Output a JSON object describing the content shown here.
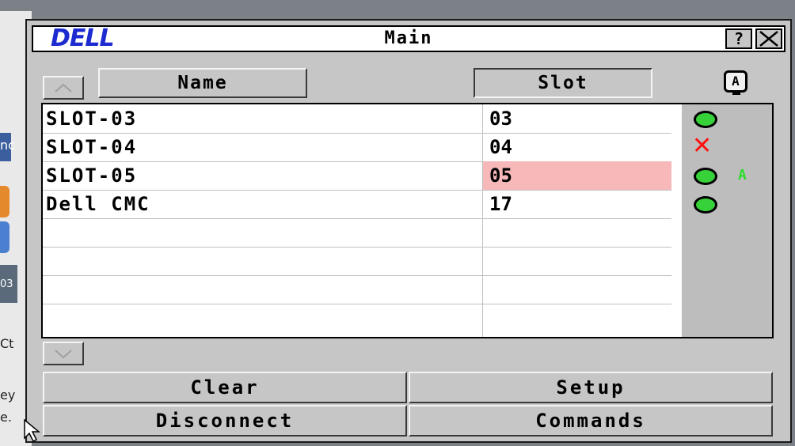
{
  "background": {
    "texts": [
      "nc",
      "Ct",
      "ey",
      "e.",
      "03"
    ]
  },
  "window": {
    "logo": "DELL",
    "title": "Main",
    "help_label": "?",
    "close_label": "X"
  },
  "header": {
    "name_label": "Name",
    "slot_label": "Slot",
    "apply_label": "A"
  },
  "rows": [
    {
      "name": "SLOT-03",
      "slot": "03",
      "status": "online",
      "highlight": false
    },
    {
      "name": "SLOT-04",
      "slot": "04",
      "status": "offline",
      "highlight": false
    },
    {
      "name": "SLOT-05",
      "slot": "05",
      "status": "online",
      "highlight": true,
      "flag": "A"
    },
    {
      "name": "Dell CMC",
      "slot": "17",
      "status": "online",
      "highlight": false
    }
  ],
  "status_colors": {
    "online": "#37d13a",
    "offline": "#ff1010",
    "highlight": "#f6b8b8"
  },
  "buttons": {
    "clear": "Clear",
    "setup": "Setup",
    "disconnect": "Disconnect",
    "commands": "Commands"
  }
}
